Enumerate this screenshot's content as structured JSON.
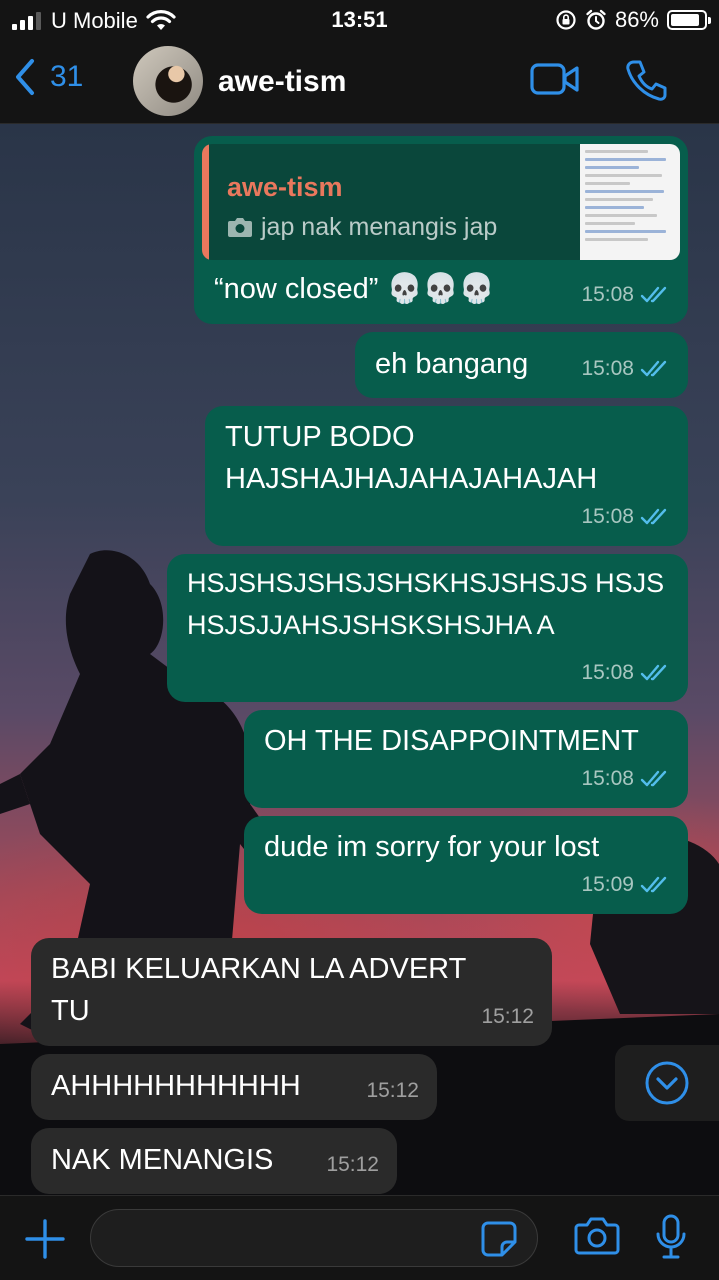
{
  "status_bar": {
    "carrier": "U Mobile",
    "time": "13:51",
    "battery": "86%",
    "battery_level": 0.86
  },
  "header": {
    "back_count": "31",
    "contact_name": "awe-tism"
  },
  "messages": [
    {
      "direction": "outgoing",
      "quote": {
        "author": "awe-tism",
        "text": "jap nak menangis jap"
      },
      "text": "“now closed” 💀💀💀",
      "time": "15:08",
      "read": true
    },
    {
      "direction": "outgoing",
      "text": "eh bangang",
      "time": "15:08",
      "read": true
    },
    {
      "direction": "outgoing",
      "text": "TUTUP BODO HAJSHAJHAJAHAJAHAJAH",
      "time": "15:08",
      "read": true
    },
    {
      "direction": "outgoing",
      "text": "HSJSHSJSHSJSHSKHSJSHSJS HSJSHSJSJJAHSJSHSKSHSJHA A",
      "time": "15:08",
      "read": true
    },
    {
      "direction": "outgoing",
      "text": "OH THE DISAPPOINTMENT",
      "time": "15:08",
      "read": true
    },
    {
      "direction": "outgoing",
      "text": "dude im sorry for your lost",
      "time": "15:09",
      "read": true
    },
    {
      "direction": "incoming",
      "text": "BABI KELUARKAN LA ADVERT TU",
      "time": "15:12"
    },
    {
      "direction": "incoming",
      "text": "AHHHHHHHHHHH",
      "time": "15:12"
    },
    {
      "direction": "incoming",
      "text": "NAK MENANGIS",
      "time": "15:12"
    }
  ],
  "composer": {
    "value": ""
  },
  "colors": {
    "accent": "#2f8fe8",
    "outgoing_bubble": "#075d4c",
    "incoming_bubble": "#2a2a2a",
    "quote_author": "#e9785d",
    "read_ticks": "#53bdeb"
  },
  "icons": {
    "signal": "signal-icon",
    "wifi": "wifi-icon",
    "orientation_lock": "orientation-lock-icon",
    "alarm": "alarm-icon",
    "battery": "battery-icon",
    "back": "chevron-left-icon",
    "video_call": "video-camera-icon",
    "voice_call": "phone-icon",
    "quote_photo": "camera-icon",
    "read_receipt": "double-check-icon",
    "scroll_down": "chevron-down-circle-icon",
    "attach": "plus-icon",
    "sticker": "sticker-icon",
    "camera": "camera-icon",
    "mic": "microphone-icon"
  }
}
